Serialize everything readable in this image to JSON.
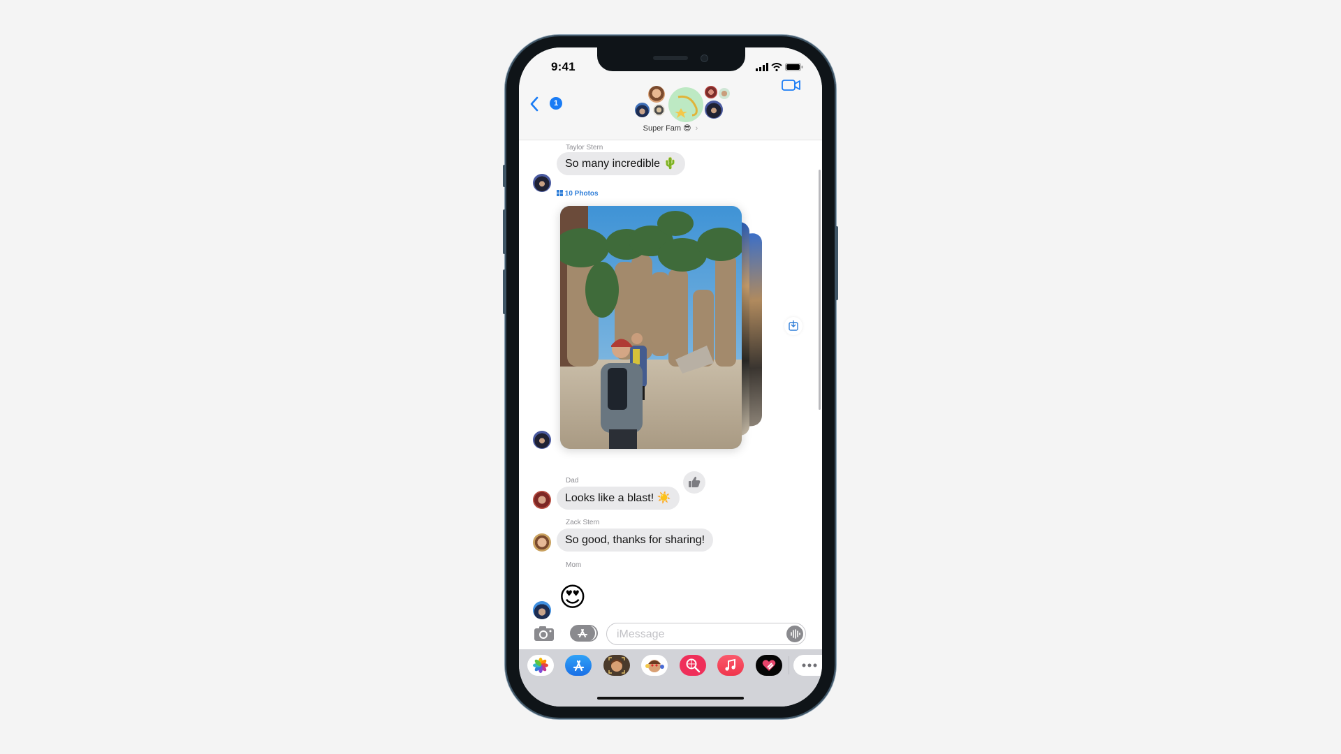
{
  "status_bar": {
    "time": "9:41"
  },
  "header": {
    "back_badge_count": "1",
    "group_name": "Super Fam 😎",
    "chevron": "›",
    "facetime_icon": "video-camera-icon"
  },
  "messages": [
    {
      "sender": "Taylor Stern",
      "text": "So many incredible 🌵",
      "type": "text"
    },
    {
      "type": "photo-stack",
      "label": "10 Photos",
      "icon": "photo-grid-icon",
      "save_icon": "save-to-library-icon"
    },
    {
      "sender": "Dad",
      "text": "Looks like a blast! ☀️",
      "type": "text",
      "tapback": "thumbs-up-icon"
    },
    {
      "sender": "Zack Stern",
      "text": "So good, thanks for sharing!",
      "type": "text"
    },
    {
      "sender": "Mom",
      "text": "😍",
      "type": "emoji"
    }
  ],
  "composer": {
    "placeholder": "iMessage",
    "camera_icon": "camera-icon",
    "apps_icon": "app-store-icon",
    "audio_icon": "audio-waveform-icon"
  },
  "app_drawer": [
    {
      "name": "Photos",
      "icon": "photos-app-icon"
    },
    {
      "name": "App Store",
      "icon": "app-store-icon"
    },
    {
      "name": "Memoji",
      "icon": "memoji-icon"
    },
    {
      "name": "Memoji Stickers",
      "icon": "memoji-stickers-icon"
    },
    {
      "name": "Images Search",
      "icon": "images-search-icon"
    },
    {
      "name": "Music",
      "icon": "music-icon"
    },
    {
      "name": "Digital Touch",
      "icon": "digital-touch-icon"
    },
    {
      "name": "More",
      "icon": "more-icon"
    }
  ],
  "colors": {
    "accent": "#1a7cf5",
    "bubble_gray": "#e9e9eb",
    "link_blue": "#2f7ed8"
  }
}
